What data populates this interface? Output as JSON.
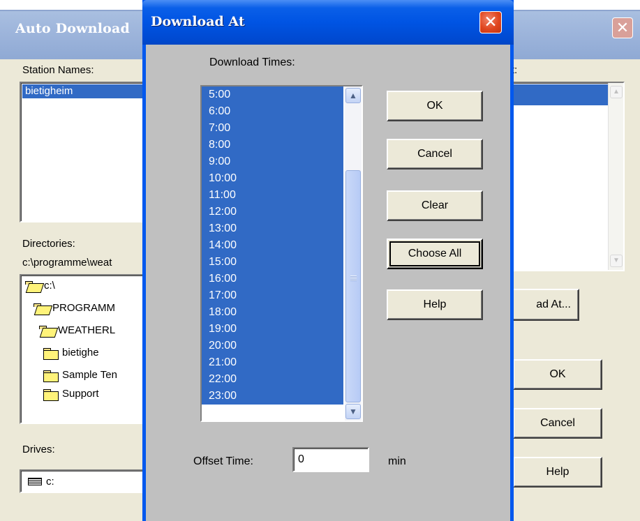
{
  "background_window": {
    "title": "Auto Download",
    "close_glyph": "✕",
    "station_names_label": "Station Names:",
    "stations": [
      "bietigheim"
    ],
    "directories_label": "Directories:",
    "directory_path": "c:\\programme\\weat",
    "tree": [
      {
        "label": "c:\\",
        "icon": "folder-open-icon"
      },
      {
        "label": "PROGRAMM",
        "icon": "folder-open-icon"
      },
      {
        "label": "WEATHERL",
        "icon": "folder-open-icon"
      },
      {
        "label": "bietighe",
        "icon": "folder-icon"
      },
      {
        "label": "Sample Ten",
        "icon": "folder-icon"
      },
      {
        "label": "Support",
        "icon": "folder-icon"
      }
    ],
    "drives_label": "Drives:",
    "drive_value": "c:",
    "right_list_label": "ist:",
    "download_at_button": "ad At...",
    "ok_button": "OK",
    "cancel_button": "Cancel",
    "help_button": "Help"
  },
  "dialog": {
    "title": "Download At",
    "close_glyph": "✕",
    "download_times_label": "Download Times:",
    "times": [
      "5:00",
      "6:00",
      "7:00",
      "8:00",
      "9:00",
      "10:00",
      "11:00",
      "12:00",
      "13:00",
      "14:00",
      "15:00",
      "16:00",
      "17:00",
      "18:00",
      "19:00",
      "20:00",
      "21:00",
      "22:00",
      "23:00"
    ],
    "all_selected": true,
    "buttons": {
      "ok": "OK",
      "cancel": "Cancel",
      "clear": "Clear",
      "choose_all": "Choose All",
      "help": "Help"
    },
    "offset_label": "Offset Time:",
    "offset_value": "0",
    "offset_unit": "min"
  },
  "colors": {
    "selection": "#316ac5",
    "dialog_title_bar": "#0054e3",
    "dialog_body": "#c0c0c0",
    "close_button": "#e0461f"
  }
}
